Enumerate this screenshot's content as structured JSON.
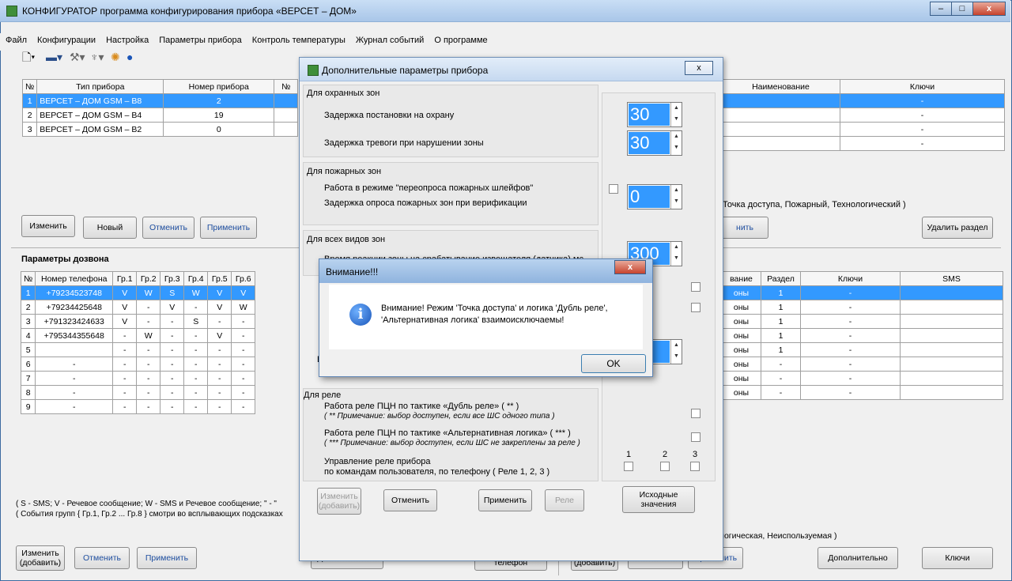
{
  "app": {
    "title": "КОНФИГУРАТОР программа конфигурирования прибора «ВЕРСЕТ – ДОМ»",
    "window_buttons": {
      "minimize": "–",
      "maximize": "□",
      "close": "x"
    }
  },
  "menu": [
    "Файл",
    "Конфигурации",
    "Настройка",
    "Параметры прибора",
    "Контроль температуры",
    "Журнал событий",
    "О программе"
  ],
  "toolbar_icons": [
    "new-file-icon",
    "device-icon",
    "tools-icon",
    "usb-icon",
    "settings-icon",
    "help-icon"
  ],
  "devices": {
    "headers": [
      "№",
      "Тип прибора",
      "Номер прибора",
      "№"
    ],
    "rows": [
      [
        "1",
        "ВЕРСЕТ – ДОМ GSM – В8",
        "2"
      ],
      [
        "2",
        "ВЕРСЕТ – ДОМ GSM – В4",
        "19"
      ],
      [
        "3",
        "ВЕРСЕТ – ДОМ GSM – В2",
        "0"
      ]
    ],
    "buttons": {
      "edit": "Изменить",
      "new": "Новый",
      "cancel": "Отменить",
      "apply": "Применить"
    }
  },
  "sections": {
    "headers": [
      "Наименование",
      "Ключи"
    ],
    "rows": [
      [
        "",
        "-"
      ],
      [
        "",
        "-"
      ],
      [
        "",
        "-"
      ],
      [
        "",
        "-"
      ]
    ],
    "hint": "Точка доступа, Пожарный, Технологический )",
    "button_apply_partial": "нить",
    "delete": "Удалить раздел"
  },
  "dial": {
    "title": "Параметры дозвона",
    "headers": [
      "№",
      "Номер телефона",
      "Гр.1",
      "Гр.2",
      "Гр.3",
      "Гр.4",
      "Гр.5",
      "Гр.6"
    ],
    "rows": [
      [
        "1",
        "+79234523748",
        "V",
        "W",
        "S",
        "W",
        "V",
        "V"
      ],
      [
        "2",
        "+79234425648",
        "V",
        "-",
        "V",
        "-",
        "V",
        "W"
      ],
      [
        "3",
        "+791323424633",
        "V",
        "-",
        "-",
        "S",
        "-",
        "-"
      ],
      [
        "4",
        "+795344355648",
        "-",
        "W",
        "-",
        "-",
        "V",
        "-"
      ],
      [
        "5",
        "",
        "-",
        "-",
        "-",
        "-",
        "-",
        "-"
      ],
      [
        "6",
        "-",
        "-",
        "-",
        "-",
        "-",
        "-",
        "-"
      ],
      [
        "7",
        "-",
        "-",
        "-",
        "-",
        "-",
        "-",
        "-"
      ],
      [
        "8",
        "-",
        "-",
        "-",
        "-",
        "-",
        "-",
        "-"
      ],
      [
        "9",
        "-",
        "-",
        "-",
        "-",
        "-",
        "-",
        "-"
      ]
    ],
    "legend1": "( S - SMS;  V - Речевое сообщение;  W - SMS и Речевое сообщение;  \" - \"",
    "legend2": "( События групп  { Гр.1, Гр.2 ... Гр.8 }  смотри во всплывающих подсказках",
    "buttons": {
      "edit": "Изменить\n(добавить)",
      "cancel": "Отменить",
      "apply": "Применить",
      "more": "Дополнительно",
      "delete": "Удалить\nтелефон"
    }
  },
  "zones": {
    "headers": [
      "вание",
      "Раздел",
      "Ключи",
      "SMS"
    ],
    "rows": [
      [
        "оны",
        "1",
        "-",
        ""
      ],
      [
        "оны",
        "1",
        "-",
        ""
      ],
      [
        "оны",
        "1",
        "-",
        ""
      ],
      [
        "оны",
        "1",
        "-",
        ""
      ],
      [
        "оны",
        "1",
        "-",
        ""
      ],
      [
        "оны",
        "-",
        "-",
        ""
      ],
      [
        "оны",
        "-",
        "-",
        ""
      ],
      [
        "оны",
        "-",
        "-",
        ""
      ]
    ],
    "hint": "( Типы зон: Охранная, Пожарная, Технологическая, Неиспользуемая )",
    "buttons": {
      "edit": "Изменить\n(добавить)",
      "cancel": "Отменить",
      "apply": "Применить",
      "more": "Дополнительно",
      "keys": "Ключи"
    }
  },
  "dialog": {
    "title": "Дополнительные параметры прибора",
    "close": "x",
    "guard_group": "Для охранных зон",
    "arm_delay": "Задержка постановки на охрану",
    "alarm_delay": "Задержка тревоги при нарушении зоны",
    "arm_delay_value": "30",
    "alarm_delay_value": "30",
    "fire_group": "Для пожарных зон",
    "fire_repoll": "Работа в режиме  \"переопроса пожарных шлейфов\"",
    "fire_verify": "Задержка опроса пожарных зон при верификации",
    "fire_verify_value": "0",
    "all_group": "Для всех видов зон",
    "reaction_time": "Время реакции зоны на срабатывание извещателя (датчика) мс",
    "reaction_value": "300",
    "partial_d": "Д",
    "partial_vr": "Вр",
    "relay_group": "Для реле",
    "relay_dub": "Работа реле ПЦН по тактике «Дубль реле»  ( ** )",
    "relay_dub_note": "( ** Примечание: выбор доступен, если все ШС одного типа )",
    "relay_alt": "Работа реле ПЦН по тактике «Альтернативная логика»  ( *** )",
    "relay_alt_note": "( *** Примечание: выбор доступен, если ШС не закреплены за реле )",
    "relay_ctrl1": "Управление реле прибора",
    "relay_ctrl2": "по командам пользователя, по телефону  ( Реле 1, 2, 3 )",
    "relay_nums": [
      "1",
      "2",
      "3"
    ],
    "buttons": {
      "edit": "Изменить\n(добавить)",
      "cancel": "Отменить",
      "apply": "Применить",
      "relay": "Реле",
      "defaults": "Исходные\nзначения"
    }
  },
  "alert": {
    "title": "Внимание!!!",
    "close": "x",
    "line1": "Внимание! Режим 'Точка доступа' и логика 'Дубль реле',",
    "line2": "'Альтернативная логика' взаимоисключаемы!",
    "ok": "OK"
  }
}
